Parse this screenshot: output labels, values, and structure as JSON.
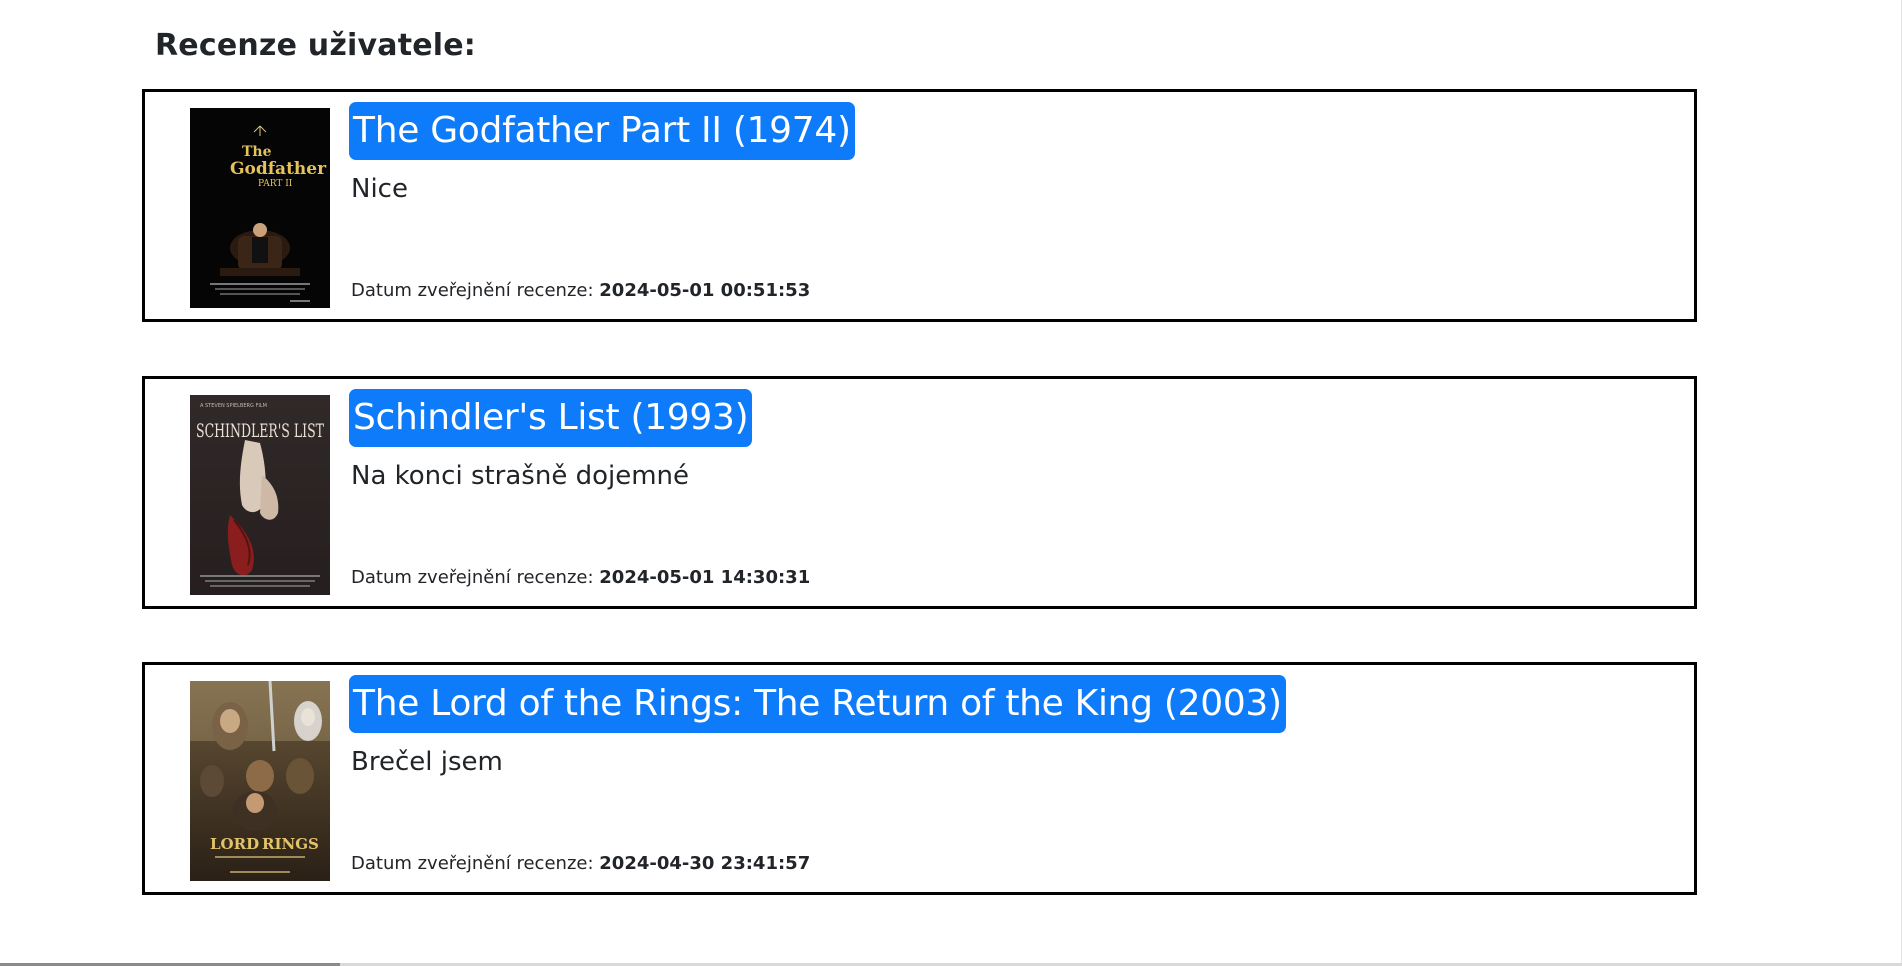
{
  "section_title": "Recenze uživatele:",
  "date_label": "Datum zveřejnění recenze:",
  "colors": {
    "title_badge_bg": "#0d7bfa",
    "title_badge_text": "#ffffff",
    "card_border": "#000000"
  },
  "reviews": [
    {
      "movie_title": "The Godfather Part II (1974)",
      "review_text": "Nice",
      "published_at": "2024-05-01 00:51:53",
      "poster_icon": "godfather-poster",
      "poster_lettering": [
        "The",
        "Godfather",
        "PART II"
      ]
    },
    {
      "movie_title": "Schindler's List (1993)",
      "review_text": "Na konci strašně dojemné",
      "published_at": "2024-05-01 14:30:31",
      "poster_icon": "schindlers-list-poster",
      "poster_lettering": [
        "SCHINDLER'S LIST"
      ]
    },
    {
      "movie_title": "The Lord of the Rings: The Return of the King (2003)",
      "review_text": "Brečel jsem",
      "published_at": "2024-04-30 23:41:57",
      "poster_icon": "lotr-return-of-the-king-poster",
      "poster_lettering": [
        "LORD",
        "RINGS"
      ]
    }
  ]
}
